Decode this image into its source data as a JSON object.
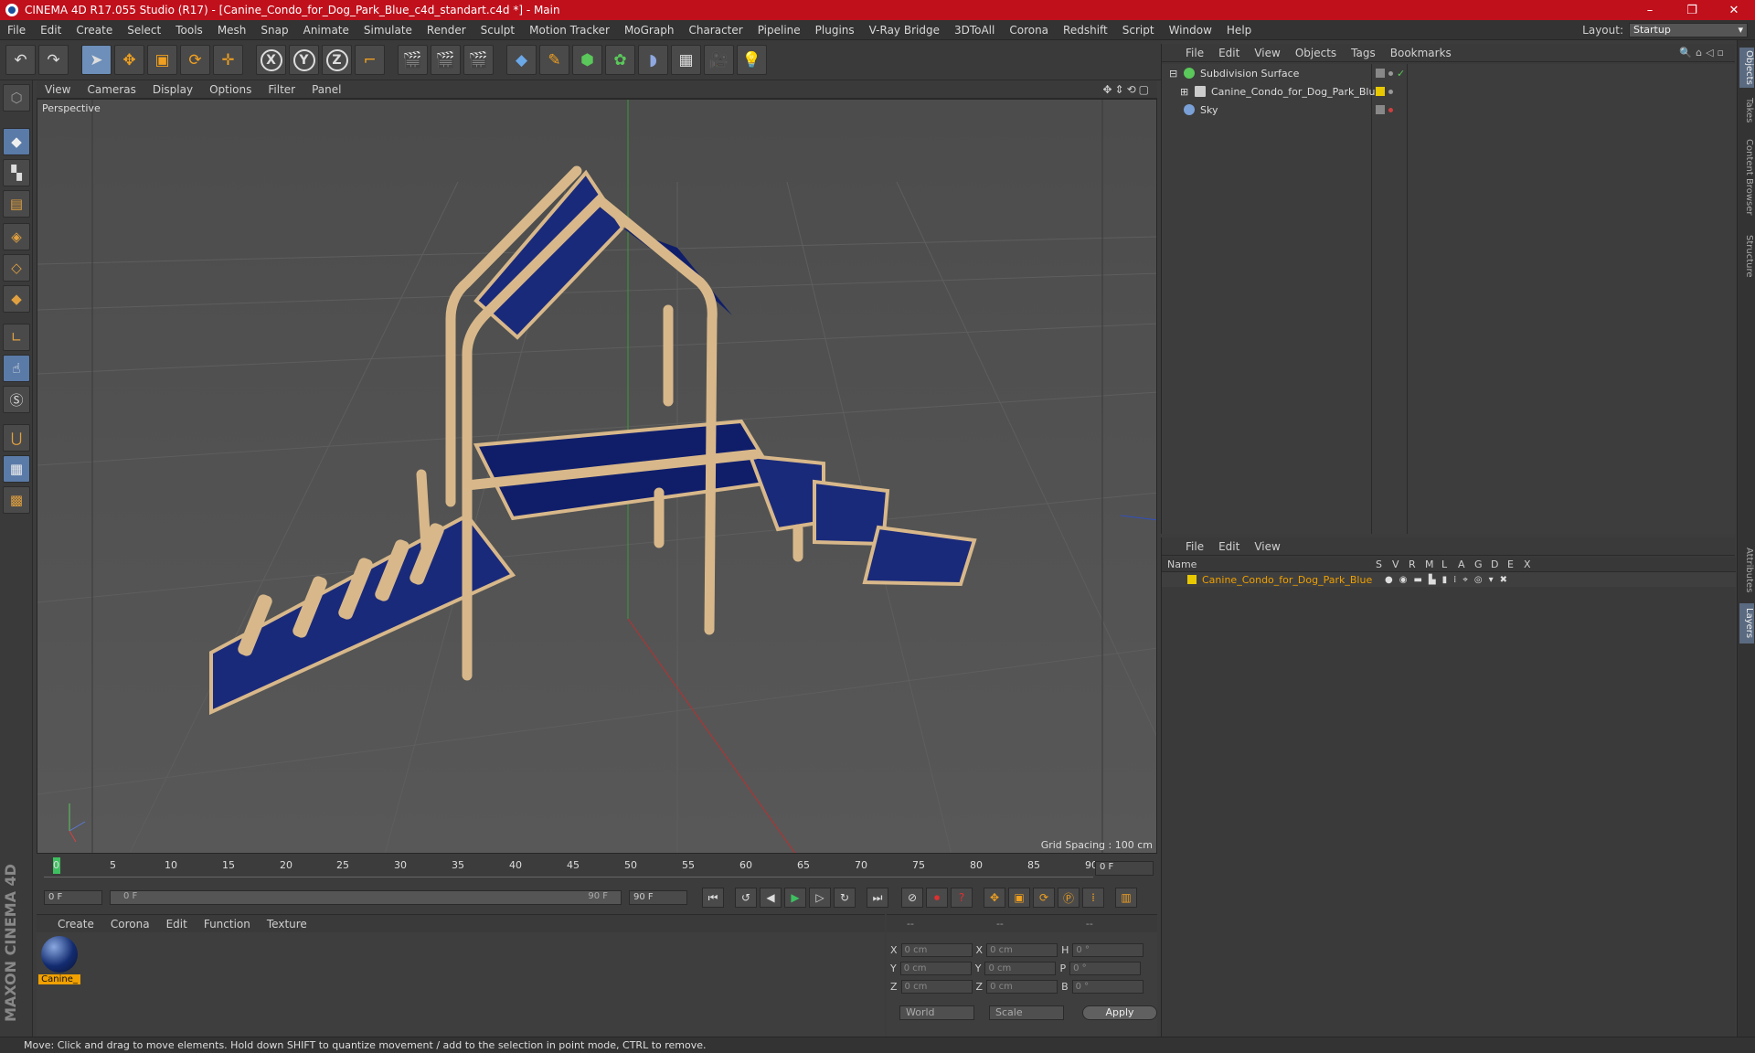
{
  "window": {
    "title": "CINEMA 4D R17.055 Studio (R17) - [Canine_Condo_for_Dog_Park_Blue_c4d_standart.c4d *] - Main",
    "controls": [
      "–",
      "❐",
      "✕"
    ]
  },
  "menu": [
    "File",
    "Edit",
    "Create",
    "Select",
    "Tools",
    "Mesh",
    "Snap",
    "Animate",
    "Simulate",
    "Render",
    "Sculpt",
    "Motion Tracker",
    "MoGraph",
    "Character",
    "Pipeline",
    "Plugins",
    "V-Ray Bridge",
    "3DToAll",
    "Corona",
    "Redshift",
    "Script",
    "Window",
    "Help"
  ],
  "layout": {
    "label": "Layout:",
    "value": "Startup"
  },
  "axes": [
    "X",
    "Y",
    "Z"
  ],
  "viewport": {
    "menu": [
      "View",
      "Cameras",
      "Display",
      "Options",
      "Filter",
      "Panel"
    ],
    "label": "Perspective",
    "grid_spacing": "Grid Spacing : 100 cm"
  },
  "timeline": {
    "ticks": [
      "0",
      "5",
      "10",
      "15",
      "20",
      "25",
      "30",
      "35",
      "40",
      "45",
      "50",
      "55",
      "60",
      "65",
      "70",
      "75",
      "80",
      "85",
      "90"
    ],
    "current_frame": "0 F",
    "start_field": "0 F",
    "slider_start": "0 F",
    "slider_end": "90 F",
    "end_field": "90 F"
  },
  "material_manager": {
    "menu": [
      "Create",
      "Corona",
      "Edit",
      "Function",
      "Texture"
    ],
    "material_label": "Canine_"
  },
  "coordinates": {
    "header": [
      "--",
      "--",
      "--"
    ],
    "rows": [
      {
        "a": "X",
        "av": "0 cm",
        "b": "X",
        "bv": "0 cm",
        "c": "H",
        "cv": "0 °"
      },
      {
        "a": "Y",
        "av": "0 cm",
        "b": "Y",
        "bv": "0 cm",
        "c": "P",
        "cv": "0 °"
      },
      {
        "a": "Z",
        "av": "0 cm",
        "b": "Z",
        "bv": "0 cm",
        "c": "B",
        "cv": "0 °"
      }
    ],
    "mode": "World",
    "transform": "Scale",
    "apply": "Apply"
  },
  "objects_panel": {
    "menu": [
      "File",
      "Edit",
      "View",
      "Objects",
      "Tags",
      "Bookmarks"
    ],
    "objects": [
      {
        "name": "Subdivision Surface",
        "color": "#5ac85a"
      },
      {
        "name": "Canine_Condo_for_Dog_Park_Blue",
        "color": "#cccccc"
      },
      {
        "name": "Sky",
        "color": "#7aa0d8"
      }
    ]
  },
  "layers_panel": {
    "menu": [
      "File",
      "Edit",
      "View"
    ],
    "columns": [
      "Name",
      "S",
      "V",
      "R",
      "M",
      "L",
      "A",
      "G",
      "D",
      "E",
      "X"
    ],
    "layer_name": "Canine_Condo_for_Dog_Park_Blue",
    "layer_color": "#e8c800"
  },
  "side_tabs": [
    "Objects",
    "Takes",
    "Content Browser",
    "Structure",
    "Attributes",
    "Layers"
  ],
  "status": "Move: Click and drag to move elements. Hold down SHIFT to quantize movement / add to the selection in point mode, CTRL to remove.",
  "colors": {
    "title_red": "#c0101c",
    "accent_orange": "#f0a000",
    "model_blue": "#1a2a7a",
    "model_tan": "#d8b88a"
  }
}
